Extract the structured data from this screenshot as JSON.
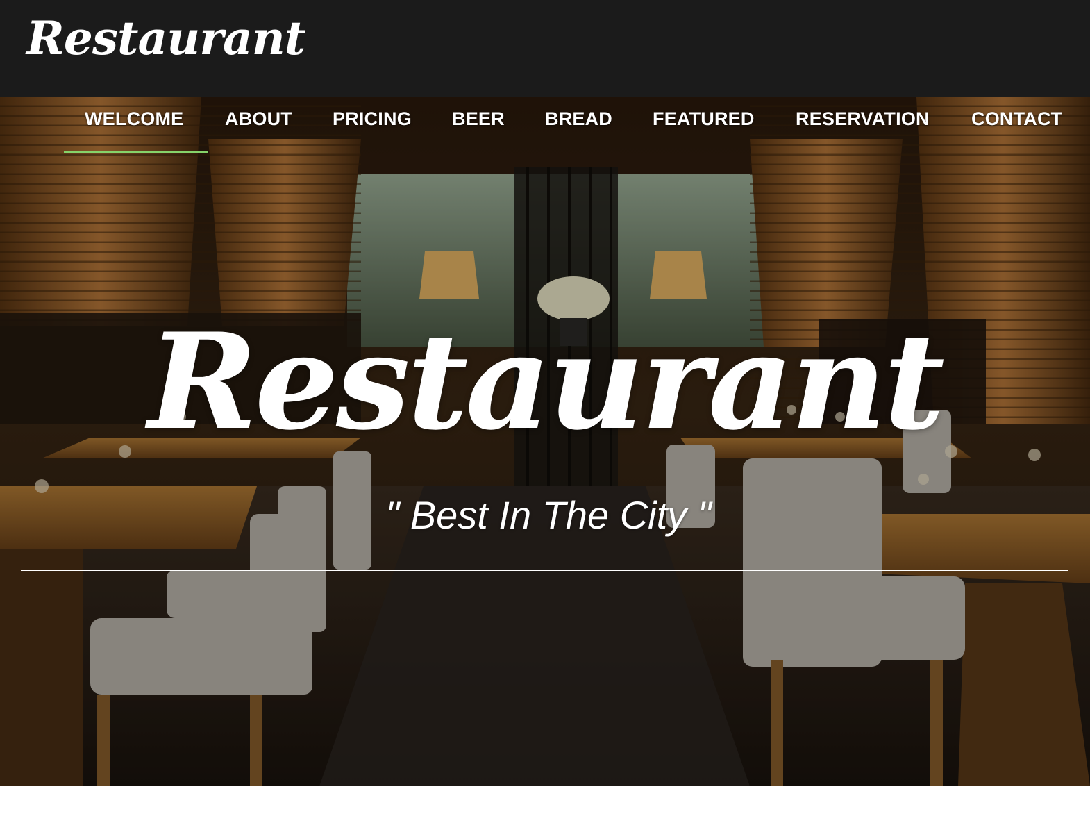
{
  "header": {
    "brand": "Restaurant"
  },
  "nav": {
    "items": [
      "WELCOME",
      "ABOUT",
      "PRICING",
      "BEER",
      "BREAD",
      "FEATURED",
      "RESERVATION",
      "CONTACT"
    ],
    "active": "WELCOME"
  },
  "hero": {
    "title": "Restaurant",
    "tagline": "\" Best In The City \""
  },
  "colors": {
    "topbar": "#1b1b1b",
    "active_underline": "#86d36a",
    "text": "#ffffff"
  }
}
